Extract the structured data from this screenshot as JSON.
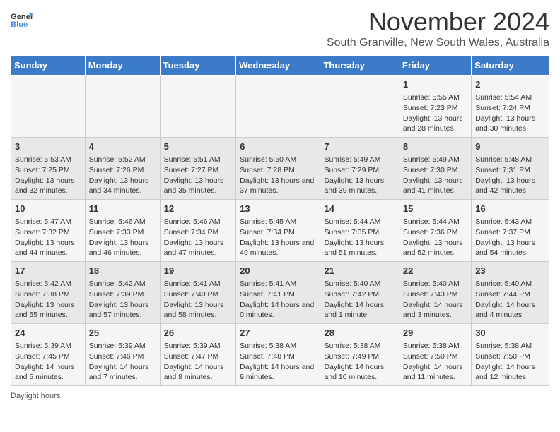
{
  "header": {
    "logo_line1": "General",
    "logo_line2": "Blue",
    "title": "November 2024",
    "subtitle": "South Granville, New South Wales, Australia"
  },
  "days_of_week": [
    "Sunday",
    "Monday",
    "Tuesday",
    "Wednesday",
    "Thursday",
    "Friday",
    "Saturday"
  ],
  "weeks": [
    [
      {
        "num": "",
        "info": ""
      },
      {
        "num": "",
        "info": ""
      },
      {
        "num": "",
        "info": ""
      },
      {
        "num": "",
        "info": ""
      },
      {
        "num": "",
        "info": ""
      },
      {
        "num": "1",
        "info": "Sunrise: 5:55 AM\nSunset: 7:23 PM\nDaylight: 13 hours and 28 minutes."
      },
      {
        "num": "2",
        "info": "Sunrise: 5:54 AM\nSunset: 7:24 PM\nDaylight: 13 hours and 30 minutes."
      }
    ],
    [
      {
        "num": "3",
        "info": "Sunrise: 5:53 AM\nSunset: 7:25 PM\nDaylight: 13 hours and 32 minutes."
      },
      {
        "num": "4",
        "info": "Sunrise: 5:52 AM\nSunset: 7:26 PM\nDaylight: 13 hours and 34 minutes."
      },
      {
        "num": "5",
        "info": "Sunrise: 5:51 AM\nSunset: 7:27 PM\nDaylight: 13 hours and 35 minutes."
      },
      {
        "num": "6",
        "info": "Sunrise: 5:50 AM\nSunset: 7:28 PM\nDaylight: 13 hours and 37 minutes."
      },
      {
        "num": "7",
        "info": "Sunrise: 5:49 AM\nSunset: 7:29 PM\nDaylight: 13 hours and 39 minutes."
      },
      {
        "num": "8",
        "info": "Sunrise: 5:49 AM\nSunset: 7:30 PM\nDaylight: 13 hours and 41 minutes."
      },
      {
        "num": "9",
        "info": "Sunrise: 5:48 AM\nSunset: 7:31 PM\nDaylight: 13 hours and 42 minutes."
      }
    ],
    [
      {
        "num": "10",
        "info": "Sunrise: 5:47 AM\nSunset: 7:32 PM\nDaylight: 13 hours and 44 minutes."
      },
      {
        "num": "11",
        "info": "Sunrise: 5:46 AM\nSunset: 7:33 PM\nDaylight: 13 hours and 46 minutes."
      },
      {
        "num": "12",
        "info": "Sunrise: 5:46 AM\nSunset: 7:34 PM\nDaylight: 13 hours and 47 minutes."
      },
      {
        "num": "13",
        "info": "Sunrise: 5:45 AM\nSunset: 7:34 PM\nDaylight: 13 hours and 49 minutes."
      },
      {
        "num": "14",
        "info": "Sunrise: 5:44 AM\nSunset: 7:35 PM\nDaylight: 13 hours and 51 minutes."
      },
      {
        "num": "15",
        "info": "Sunrise: 5:44 AM\nSunset: 7:36 PM\nDaylight: 13 hours and 52 minutes."
      },
      {
        "num": "16",
        "info": "Sunrise: 5:43 AM\nSunset: 7:37 PM\nDaylight: 13 hours and 54 minutes."
      }
    ],
    [
      {
        "num": "17",
        "info": "Sunrise: 5:42 AM\nSunset: 7:38 PM\nDaylight: 13 hours and 55 minutes."
      },
      {
        "num": "18",
        "info": "Sunrise: 5:42 AM\nSunset: 7:39 PM\nDaylight: 13 hours and 57 minutes."
      },
      {
        "num": "19",
        "info": "Sunrise: 5:41 AM\nSunset: 7:40 PM\nDaylight: 13 hours and 58 minutes."
      },
      {
        "num": "20",
        "info": "Sunrise: 5:41 AM\nSunset: 7:41 PM\nDaylight: 14 hours and 0 minutes."
      },
      {
        "num": "21",
        "info": "Sunrise: 5:40 AM\nSunset: 7:42 PM\nDaylight: 14 hours and 1 minute."
      },
      {
        "num": "22",
        "info": "Sunrise: 5:40 AM\nSunset: 7:43 PM\nDaylight: 14 hours and 3 minutes."
      },
      {
        "num": "23",
        "info": "Sunrise: 5:40 AM\nSunset: 7:44 PM\nDaylight: 14 hours and 4 minutes."
      }
    ],
    [
      {
        "num": "24",
        "info": "Sunrise: 5:39 AM\nSunset: 7:45 PM\nDaylight: 14 hours and 5 minutes."
      },
      {
        "num": "25",
        "info": "Sunrise: 5:39 AM\nSunset: 7:46 PM\nDaylight: 14 hours and 7 minutes."
      },
      {
        "num": "26",
        "info": "Sunrise: 5:39 AM\nSunset: 7:47 PM\nDaylight: 14 hours and 8 minutes."
      },
      {
        "num": "27",
        "info": "Sunrise: 5:38 AM\nSunset: 7:48 PM\nDaylight: 14 hours and 9 minutes."
      },
      {
        "num": "28",
        "info": "Sunrise: 5:38 AM\nSunset: 7:49 PM\nDaylight: 14 hours and 10 minutes."
      },
      {
        "num": "29",
        "info": "Sunrise: 5:38 AM\nSunset: 7:50 PM\nDaylight: 14 hours and 11 minutes."
      },
      {
        "num": "30",
        "info": "Sunrise: 5:38 AM\nSunset: 7:50 PM\nDaylight: 14 hours and 12 minutes."
      }
    ]
  ],
  "footer": {
    "daylight_label": "Daylight hours"
  }
}
